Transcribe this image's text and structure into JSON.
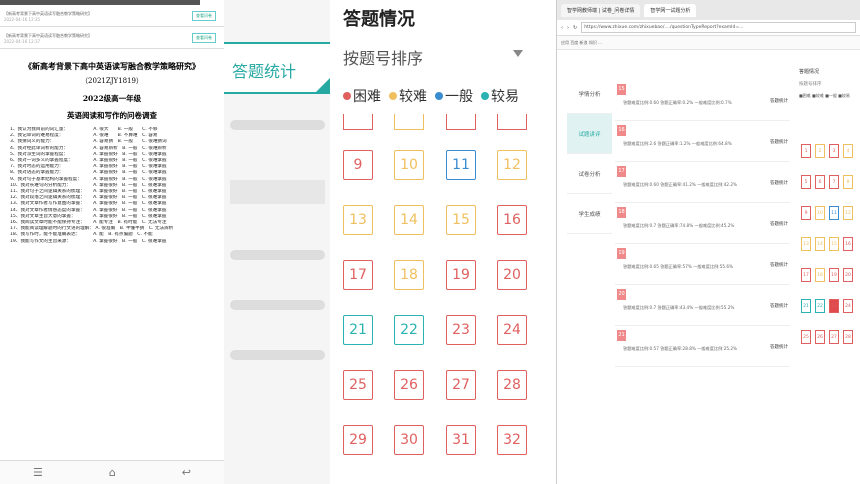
{
  "left": {
    "messages": [
      {
        "title": "【新高考背景下高中英语读写融合教学策略研究】",
        "time": "2022-04-16 12:35",
        "action": "查看问卷"
      },
      {
        "title": "【新高考背景下高中英语读写融合教学策略研究】",
        "time": "2022-04-16 12:37",
        "action": "查看问卷"
      }
    ],
    "doc_title": "《新高考背景下高中英语读写融合教学策略研究》",
    "doc_code": "（2021ZJY1819）",
    "doc_class": "2022级高一年级",
    "doc_survey": "英语阅读和写作的问卷调查",
    "questions": [
      "1、我认为我目前的词汇量：　　　　　　A. 很大　　B. 一般　　C. 不够",
      "2、我记单词的难易程度：　　　　　　　A. 很难　　B. 不算难　C. 容易",
      "3、我猜词义的能力：　　　　　　　　　A. 容易猜　B. 一般　　C. 很难猜词",
      "4、我对经此单词析的能力：　　　　　　A. 容易辨析　B. 一般　C. 很难辨析",
      "5、我对派生词的掌握程度：　　　　　　A. 掌握很好　B. 一般　C. 很难掌握",
      "6、我对一词多义的掌握程度：　　　　　A. 掌握很好　B. 一般　C. 很难掌握",
      "7、我对时态的运用能力：　　　　　　　A. 掌握很好　B. 一般　C. 很难掌握",
      "8、我对语态的掌握能力：　　　　　　　A. 掌握很好　B. 一般　C. 很难掌握",
      "9、我对句子基本结构的掌握程度：　　　A. 掌握很好　B. 一般　C. 很难掌握",
      "10、我对长难句的分析能力：　　　　　 A. 掌握很好　B. 一般　C. 很难掌握",
      "11、我对句子之间逻辑关系的梳理：　　 A. 掌握很好　B. 一般　C. 很难掌握",
      "12、我对段落之间逻辑关系的梳理：　　 A. 掌握很好　B. 一般　C. 很难掌握",
      "13、我对文章作者写作意图的掌握：　　 A. 掌握很好　B. 一般　C. 很难掌握",
      "14、我对文章作者情感态度的掌握：　　 A. 掌握很好　B. 一般　C. 很难掌握",
      "15、我对文章主旨大意的掌握：　　　　 A. 掌握很好　B. 一般　C. 很难掌握",
      "16、我阅读文章时能不能保持专注：　　 A. 能专注　B. 有时能　C. 无法专注",
      "17、我能阅读理解题时的行文语的理解：  A. 很准确　B. 半懂半猜　C. 无法辨析",
      "18、我写作时，能不能准确表达：　　　 A. 能　B. 有点偏题　C. 不能",
      "19、我能写作文的主旨来源：　　　　　 A. 掌握很好　B. 一般　C. 很难掌握"
    ],
    "nav": [
      "☰",
      "⌂",
      "↩"
    ]
  },
  "mid": {
    "tab_label": "答题统计"
  },
  "grid": {
    "title": "答题情况",
    "sort_label": "按题号排序",
    "legend": [
      {
        "label": "困难",
        "color": "#e06060"
      },
      {
        "label": "较难",
        "color": "#f0c060"
      },
      {
        "label": "一般",
        "color": "#3a8cd0"
      },
      {
        "label": "较易",
        "color": "#2ab3b0"
      }
    ],
    "rows": [
      [
        {
          "n": "9",
          "c": "red"
        },
        {
          "n": "10",
          "c": "yellow"
        },
        {
          "n": "11",
          "c": "blue"
        },
        {
          "n": "12",
          "c": "yellow"
        }
      ],
      [
        {
          "n": "13",
          "c": "yellow"
        },
        {
          "n": "14",
          "c": "yellow"
        },
        {
          "n": "15",
          "c": "yellow"
        },
        {
          "n": "16",
          "c": "red"
        }
      ],
      [
        {
          "n": "17",
          "c": "red"
        },
        {
          "n": "18",
          "c": "yellow"
        },
        {
          "n": "19",
          "c": "red"
        },
        {
          "n": "20",
          "c": "red"
        }
      ],
      [
        {
          "n": "21",
          "c": "teal"
        },
        {
          "n": "22",
          "c": "teal"
        },
        {
          "n": "23",
          "c": "red"
        },
        {
          "n": "24",
          "c": "red"
        }
      ],
      [
        {
          "n": "25",
          "c": "red"
        },
        {
          "n": "26",
          "c": "red"
        },
        {
          "n": "27",
          "c": "red"
        },
        {
          "n": "28",
          "c": "red"
        }
      ],
      [
        {
          "n": "29",
          "c": "red"
        },
        {
          "n": "30",
          "c": "red"
        },
        {
          "n": "31",
          "c": "red"
        },
        {
          "n": "32",
          "c": "red"
        }
      ]
    ]
  },
  "browser": {
    "tabs": [
      "智学网教师端 | 试卷_问卷详情",
      "智学网一试题分析"
    ],
    "address": "https://www.zhixue.com/zhixuebao/..../questionTypeReport?examId=...",
    "bookmarks": "应用 百度 新浪 知识 ...",
    "side": [
      "学情分析",
      "试题讲评",
      "试卷分析",
      "学生成绩"
    ],
    "rows": [
      {
        "n": "15",
        "info": "答题难度比例:0.60 答题正确率:0.2%  一般难度比例:0.7%",
        "btn": "答题统计"
      },
      {
        "n": "16",
        "info": "答题难度比例:2.6 答题正确率:1.2%  一般难度比例:64.8%",
        "btn": "答题统计"
      },
      {
        "n": "17",
        "info": "答题难度比例:0.60 答题正确率:41.2% 一般难度比例:42.2%",
        "btn": "答题统计"
      },
      {
        "n": "18",
        "info": "答题难度比例:0.7 答题正确率:74.8% 一般难度比例:45.2%",
        "btn": "答题统计"
      },
      {
        "n": "19",
        "info": "答题难度比例:0.65 答题正确率:57% 一般难度比例:55.6%",
        "btn": "答题统计"
      },
      {
        "n": "20",
        "info": "答题难度比例:0.7 答题正确率:43.4% 一般难度比例:55.2%",
        "btn": "答题统计"
      },
      {
        "n": "21",
        "info": "答题难度比例:0.57 答题正确率:28.8% 一般难度比例:25.2%",
        "btn": "答题统计"
      }
    ],
    "mini_title": "答题情况",
    "mini_sort": "按题号排序",
    "mini_legend": "■困难 ■较难 ■一般 ■较易"
  }
}
